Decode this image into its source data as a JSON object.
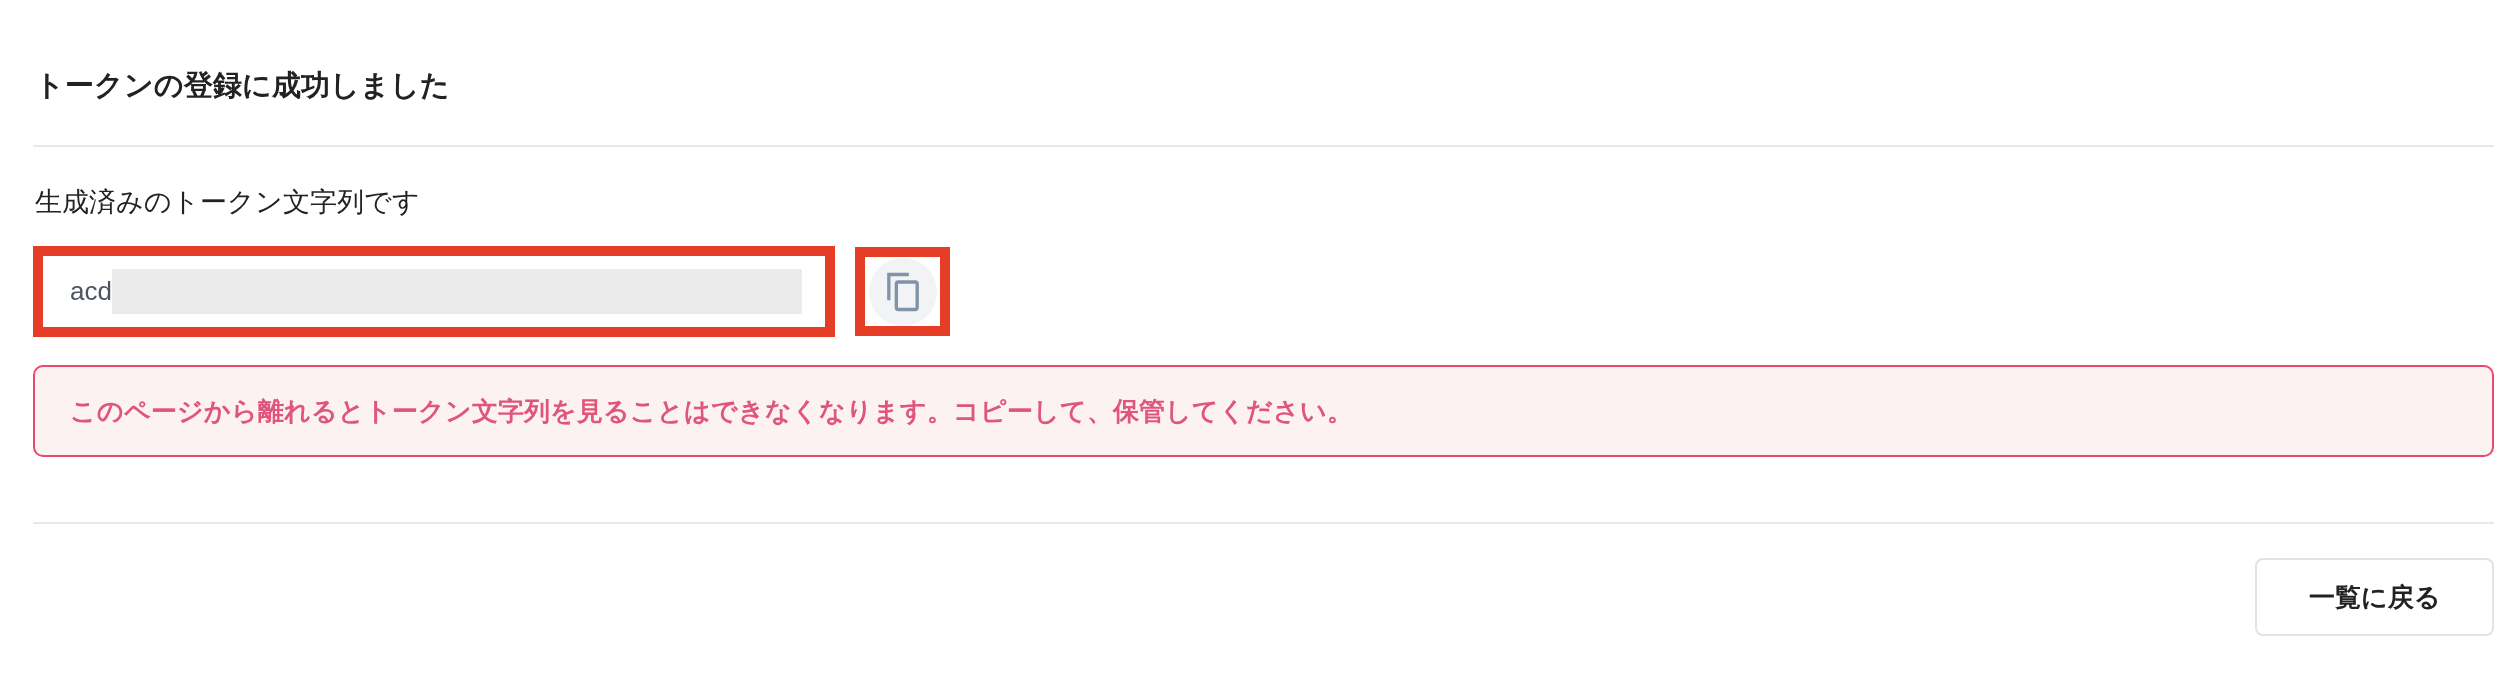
{
  "title": "トークンの登録に成功しました",
  "token_field": {
    "label": "生成済みのトークン文字列です",
    "value": "acd",
    "redacted": true,
    "highlighted": true
  },
  "copy_button": {
    "highlighted": true
  },
  "warning": {
    "text": "このページから離れるとトークン文字列を見ることはできなくなります。コピーして、保管してください。"
  },
  "buttons": [
    {
      "label": "一覧に戻る"
    }
  ]
}
